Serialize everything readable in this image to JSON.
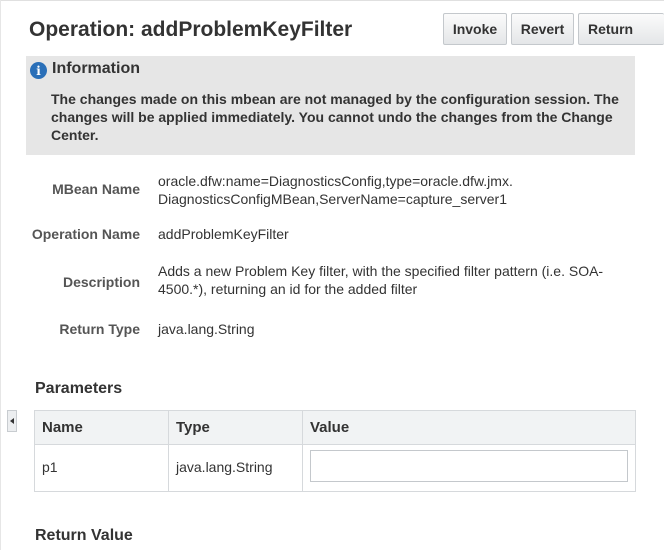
{
  "operation": {
    "title": "Operation: addProblemKeyFilter"
  },
  "toolbar": {
    "invoke_label": "Invoke",
    "revert_label": "Revert",
    "return_label": "Return"
  },
  "info": {
    "icon": "info-icon",
    "icon_glyph": "i",
    "title": "Information",
    "message": "The changes made on this mbean are not managed by the configuration session. The changes will be applied immediately. You cannot undo the changes from the Change Center."
  },
  "properties": {
    "mbean_name": {
      "label": "MBean Name",
      "value": "oracle.dfw:name=DiagnosticsConfig,type=oracle.dfw.jmx.\nDiagnosticsConfigMBean,ServerName=capture_server1"
    },
    "operation_name": {
      "label": "Operation Name",
      "value": "addProblemKeyFilter"
    },
    "description": {
      "label": "Description",
      "value": "Adds a new Problem Key filter, with the specified filter pattern (i.e. SOA-4500.*), returning an id for the added filter"
    },
    "return_type": {
      "label": "Return Type",
      "value": "java.lang.String"
    }
  },
  "parameters": {
    "heading": "Parameters",
    "columns": [
      "Name",
      "Type",
      "Value"
    ],
    "rows": [
      {
        "name": "p1",
        "type": "java.lang.String",
        "value": ""
      }
    ]
  },
  "return_value": {
    "heading": "Return Value"
  },
  "colors": {
    "info_bg": "#e6e6e6",
    "info_icon": "#2a6fb8",
    "text": "#333333",
    "label": "#555555"
  }
}
